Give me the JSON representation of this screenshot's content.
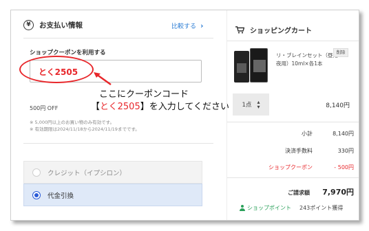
{
  "payment": {
    "icon": "yen-circle-icon",
    "title": "お支払い情報",
    "compare_link": "比較する",
    "coupon_label": "ショップクーポンを利用する",
    "coupon_value": "とく2505",
    "discount_text": "500円 OFF",
    "note1": "※ 5,000円以上のお買い物のみ有効です。",
    "note2": "※ 有効期限は2024/11/18から2024/11/19までです。",
    "options": [
      {
        "label": "クレジット（イプシロン）",
        "selected": false
      },
      {
        "label": "代金引換",
        "selected": true
      }
    ]
  },
  "annotation": {
    "line1": "ここにクーポンコード",
    "line2_prefix": "【",
    "line2_code": "とく2505",
    "line2_suffix": "】を入力してください"
  },
  "cart": {
    "title": "ショッピングカート",
    "product_name": "リ・ブレインセット（昼用・夜用）10ml×各1本",
    "delete_label": "削除",
    "quantity": "1点",
    "item_price": "8,140円",
    "subtotal_label": "小計",
    "subtotal_value": "8,140円",
    "fee_label": "決済手数料",
    "fee_value": "330円",
    "coupon_label": "ショップクーポン",
    "coupon_value": "- 500円",
    "total_label": "ご請求額",
    "total_value": "7,970円",
    "points_label": "ショップポイント",
    "points_value": "243ポイント獲得"
  },
  "colors": {
    "accent_blue": "#2f7fd5",
    "coupon_red": "#e8272b",
    "points_green": "#2aa05a",
    "selected_bg": "#dfe9f8"
  }
}
